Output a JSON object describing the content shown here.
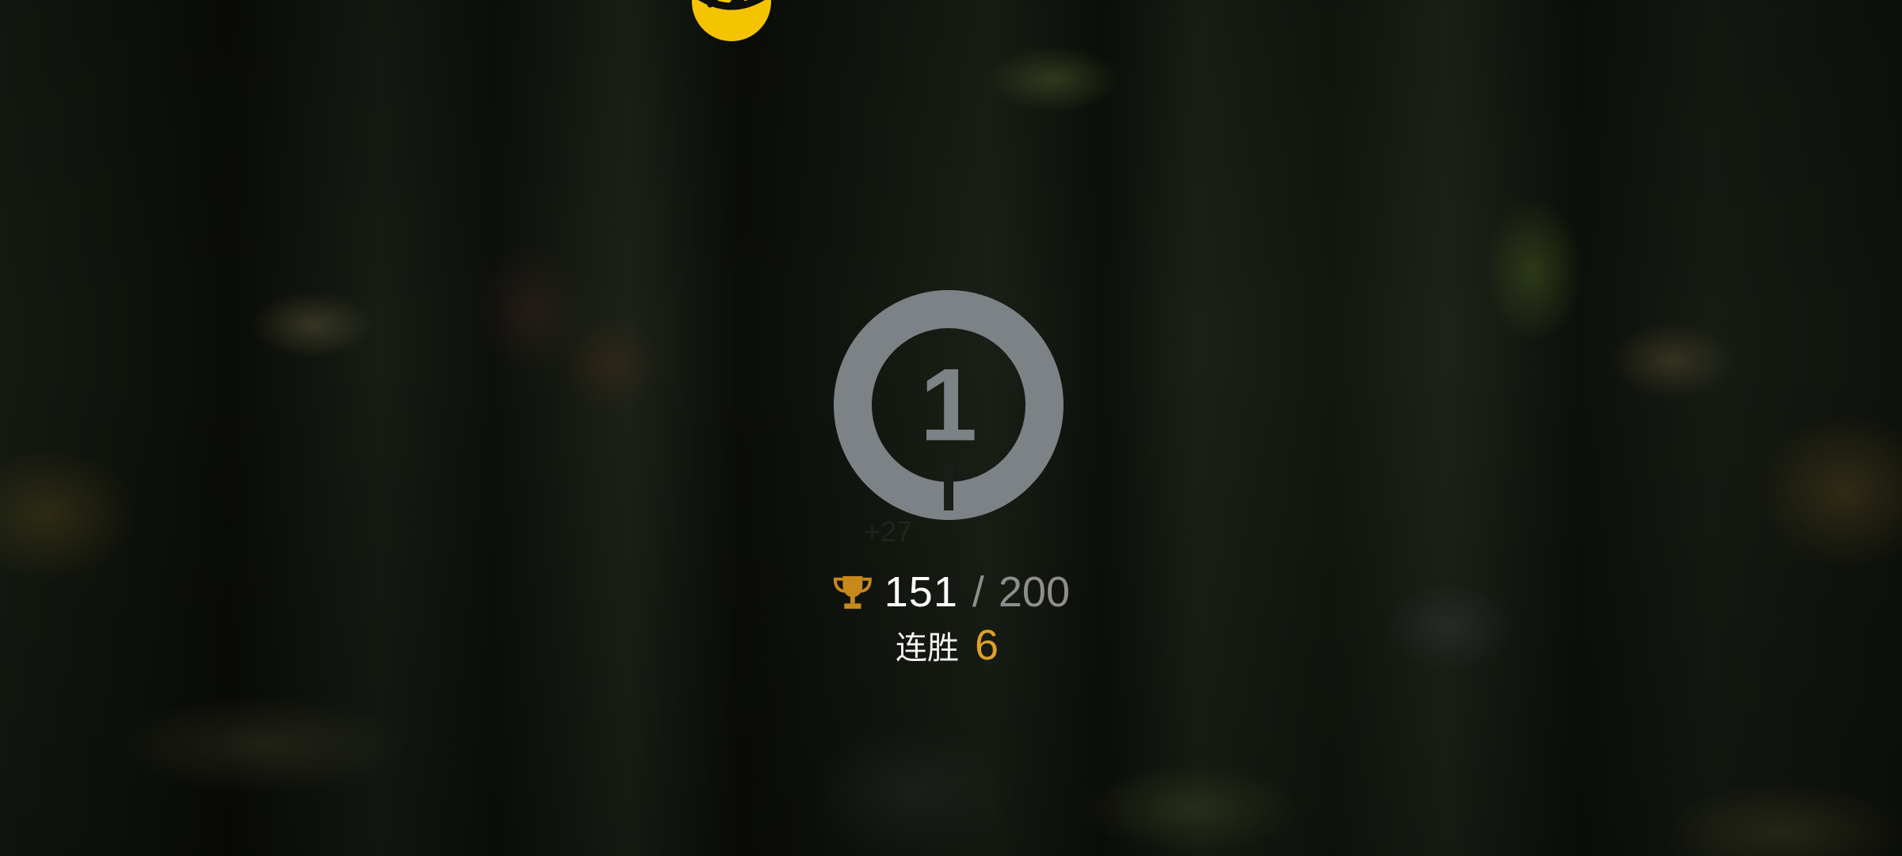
{
  "rank": {
    "placement": "1",
    "badge_color": "#7d8287"
  },
  "score": {
    "current": "151",
    "separator": "/",
    "max": "200",
    "icon": "trophy-icon",
    "icon_color": "#c8891c"
  },
  "win_streak": {
    "label": "连胜",
    "value": "6",
    "value_color": "#e0a028"
  },
  "top_emblem": {
    "icon": "gold-emblem-icon",
    "color": "#f5c400"
  }
}
